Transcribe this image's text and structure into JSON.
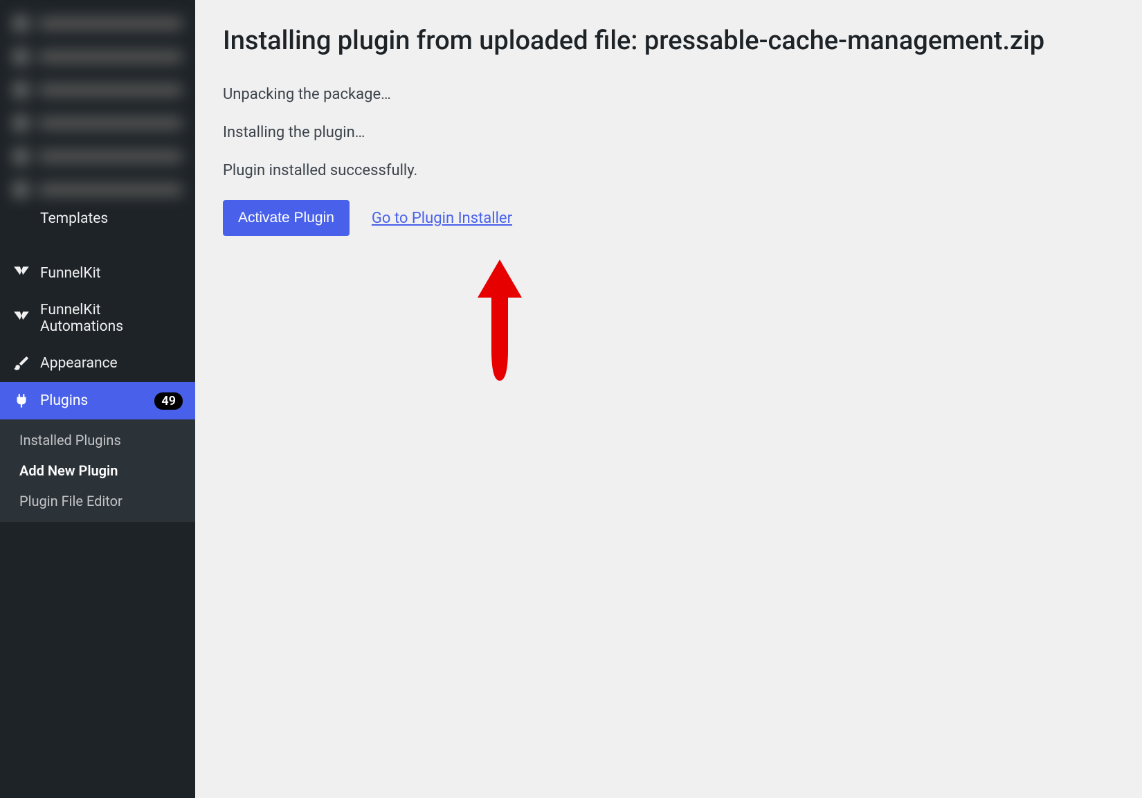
{
  "sidebar": {
    "partial_item": "Templates",
    "items": [
      {
        "label": "FunnelKit",
        "icon": "funnelkit"
      },
      {
        "label": "FunnelKit Automations",
        "icon": "funnelkit"
      },
      {
        "label": "Appearance",
        "icon": "brush"
      },
      {
        "label": "Plugins",
        "icon": "plug",
        "badge": "49",
        "active": true
      }
    ],
    "submenu": [
      {
        "label": "Installed Plugins"
      },
      {
        "label": "Add New Plugin",
        "active": true
      },
      {
        "label": "Plugin File Editor"
      }
    ]
  },
  "main": {
    "title": "Installing plugin from uploaded file: pressable-cache-management.zip",
    "status": [
      "Unpacking the package…",
      "Installing the plugin…",
      "Plugin installed successfully."
    ],
    "activate_button": "Activate Plugin",
    "installer_link": "Go to Plugin Installer"
  },
  "annotation": {
    "arrow_color": "#e60000"
  }
}
